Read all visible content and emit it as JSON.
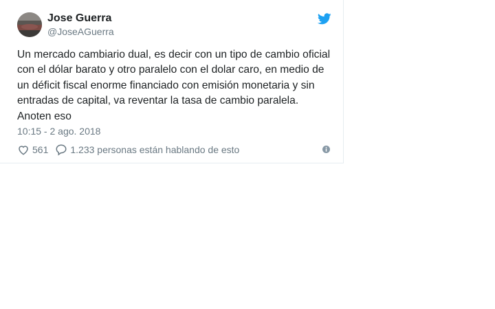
{
  "author": {
    "display_name": "Jose Guerra",
    "handle": "@JoseAGuerra"
  },
  "tweet": {
    "text": "Un mercado cambiario dual, es decir con un tipo de cambio oficial\ncon el dólar barato y otro paralelo con el dolar caro, en medio de\nun déficit fiscal enorme financiado con emisión monetaria y sin\nentradas de capital, va reventar la tasa de cambio paralela.\nAnoten eso",
    "timestamp": "10:15 - 2 ago. 2018"
  },
  "actions": {
    "like_count": "561",
    "conversation_text": "1.233 personas están hablando de esto"
  },
  "icons": {
    "brand": "twitter-bird-icon",
    "like": "heart-icon",
    "reply": "speech-bubble-icon",
    "info": "info-icon"
  },
  "colors": {
    "brand": "#1da1f2",
    "secondary_text": "#697882",
    "primary_text": "#1c2022"
  }
}
